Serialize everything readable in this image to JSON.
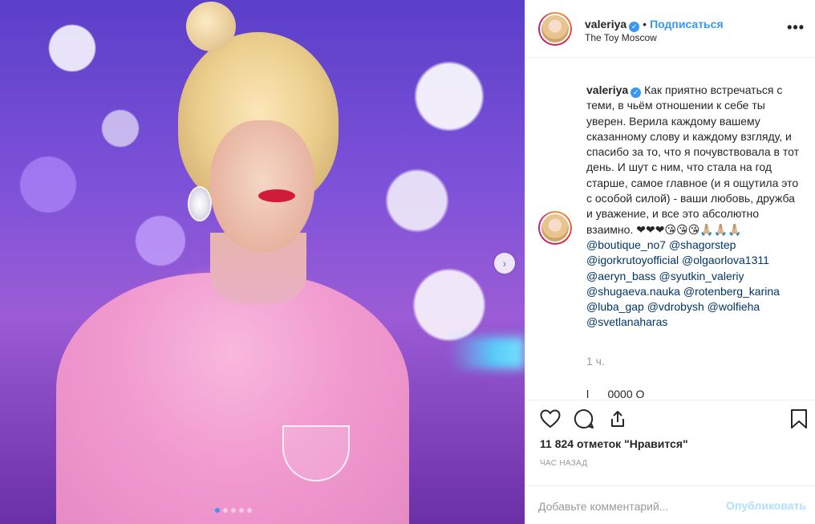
{
  "post": {
    "username": "valeriya",
    "verified_symbol": "✓",
    "dot": "•",
    "follow_label": "Подписаться",
    "location": "The Toy Moscow",
    "more_icon": "more-dots-icon",
    "more_glyph": "•••"
  },
  "caption": {
    "username": "valeriya",
    "text": "Как приятно встречаться с теми, в чьём отношении к себе ты уверен. Верила каждому вашему сказанному слову и каждому взгляду, и спасибо за то, что я почувствовала в тот день. И шут с ним, что стала на год старше, самое главное (и я ощутила это с особой силой) - ваши любовь, дружба и уважение, и все это абсолютно взаимно. ❤❤❤😘😘😘🙏🏼🙏🏼🙏🏼",
    "mentions": [
      "@boutique_no7 @shagorstep",
      "@igorkrutoyofficial @olgaorlova1311",
      "@aeryn_bass @syutkin_valeriy",
      "@shugaeva.nauka @rotenberg_karina",
      "@luba_gap @vdrobysh @wolfieha",
      "@svetlanaharas"
    ],
    "time": "1 ч.",
    "next_comment_partial": "l  __  0000  O"
  },
  "actions": {
    "like_icon": "heart-icon",
    "comment_icon": "comment-icon",
    "share_icon": "share-icon",
    "save_icon": "bookmark-icon"
  },
  "likes_text": "11 824 отметок \"Нравится\"",
  "posted_ago": "ЧАС НАЗАД",
  "comment_box": {
    "placeholder": "Добавьте комментарий...",
    "publish_label": "Опубликовать"
  },
  "carousel": {
    "next_icon": "chevron-right-icon",
    "next_glyph": "›",
    "slide_count": 5,
    "active_slide": 1
  },
  "colors": {
    "accent": "#3897f0",
    "publish_disabled": "#b2dffc",
    "mention": "#003569",
    "muted": "#999999"
  }
}
